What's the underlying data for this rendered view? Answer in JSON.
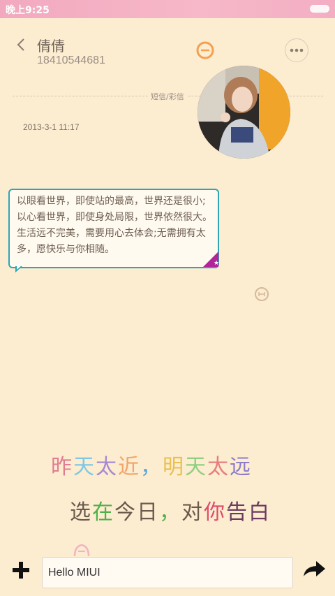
{
  "status_bar": {
    "time": "晚上9:25"
  },
  "header": {
    "contact_name": "倩倩",
    "contact_number": "18410544681"
  },
  "thread": {
    "divider_label": "短信/彩信",
    "timestamp": "2013-3-1 11:17",
    "message_text": "以眼看世界，即使站的最高，世界还是很小;以心看世界，即使身处局限，世界依然很大。生活远不完美，需要用心去体会;无需拥有太多，愿快乐与你相随。"
  },
  "wallpaper_text": {
    "line1": [
      {
        "text": "昨",
        "color": "#e07d93"
      },
      {
        "text": "天",
        "color": "#7fc7e6"
      },
      {
        "text": "太",
        "color": "#a58ad0"
      },
      {
        "text": "近",
        "color": "#f2a46a"
      },
      {
        "text": "，",
        "color": "#5aa8d6"
      },
      {
        "text": "明",
        "color": "#e7c14f"
      },
      {
        "text": "天",
        "color": "#8fcf7f"
      },
      {
        "text": "太",
        "color": "#e77e7e"
      },
      {
        "text": "远",
        "color": "#8c7cc9"
      }
    ],
    "line2": [
      {
        "text": "选",
        "color": "#6b5a4e"
      },
      {
        "text": "在",
        "color": "#4fb04a"
      },
      {
        "text": "今",
        "color": "#6b5a4e"
      },
      {
        "text": "日",
        "color": "#6b5a4e"
      },
      {
        "text": "，",
        "color": "#4fb04a"
      },
      {
        "text": "对",
        "color": "#6b5a4e"
      },
      {
        "text": "你",
        "color": "#e14a6a"
      },
      {
        "text": "告",
        "color": "#6b3a5e"
      },
      {
        "text": "白",
        "color": "#6b3a5e"
      }
    ]
  },
  "composer": {
    "input_value": "Hello MIUI"
  },
  "colors": {
    "background": "#fcecd0",
    "bubble_border": "#2aa6b6",
    "badge": "#b0269a"
  }
}
